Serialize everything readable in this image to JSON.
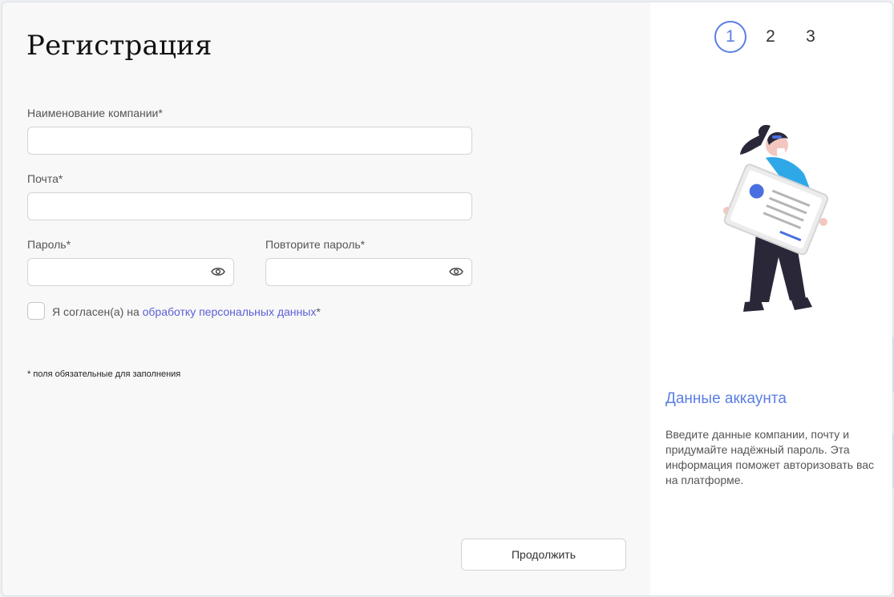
{
  "form": {
    "title": "Регистрация",
    "company": {
      "label": "Наименование компании*",
      "value": "",
      "placeholder": ""
    },
    "email": {
      "label": "Почта*",
      "value": "",
      "placeholder": ""
    },
    "password": {
      "label": "Пароль*",
      "value": "",
      "placeholder": ""
    },
    "password_repeat": {
      "label": "Повторите пароль*",
      "value": "",
      "placeholder": ""
    },
    "agree": {
      "prefix": "Я согласен(а) на",
      "link": "обработку персональных данных",
      "suffix": "*",
      "checked": false
    },
    "required_note": "* поля обязательные для заполнения",
    "continue_label": "Продолжить"
  },
  "sidebar": {
    "steps": [
      {
        "label": "1",
        "active": true
      },
      {
        "label": "2",
        "active": false
      },
      {
        "label": "3",
        "active": false
      }
    ],
    "title": "Данные аккаунта",
    "description": "Введите данные компании, почту и придумайте надёжный пароль. Эта информация поможет авторизовать вас на платформе."
  },
  "colors": {
    "accent": "#5b7ee5",
    "link": "#5b5fd6",
    "background": "#f8f8f8"
  },
  "icons": {
    "password_toggle": "eye-icon"
  }
}
